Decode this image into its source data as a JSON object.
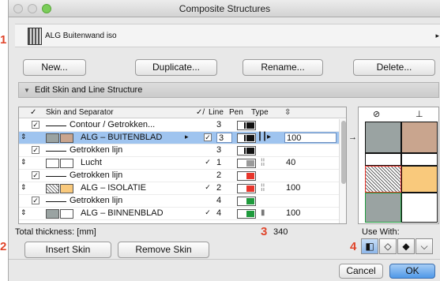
{
  "window": {
    "title": "Composite Structures"
  },
  "callouts": {
    "one": "1",
    "two": "2",
    "three": "3",
    "four": "4"
  },
  "composite": {
    "name": "ALG Buitenwand iso"
  },
  "toolbar": {
    "new": "New...",
    "duplicate": "Duplicate...",
    "rename": "Rename...",
    "delete": "Delete..."
  },
  "section": {
    "label": "Edit Skin and Line Structure",
    "toggle": "▼"
  },
  "table": {
    "headers": {
      "check": "✓",
      "name": "Skin and Separator",
      "line": "Line",
      "pen": "Pen",
      "type": "Type",
      "thk_icon": "⇳"
    },
    "rows": [
      {
        "name": "Contour / Getrokken...",
        "pen": "3"
      },
      {
        "name": "ALG – BUITENBLAD",
        "pen": "3",
        "thickness": "100"
      },
      {
        "name": "Getrokken lijn",
        "pen": "3"
      },
      {
        "name": "Lucht",
        "pen": "1",
        "thickness": "40"
      },
      {
        "name": "Getrokken lijn",
        "pen": "2"
      },
      {
        "name": "ALG – ISOLATIE",
        "pen": "2",
        "thickness": "100"
      },
      {
        "name": "Getrokken lijn",
        "pen": "4"
      },
      {
        "name": "ALG – BINNENBLAD",
        "pen": "4",
        "thickness": "100"
      }
    ]
  },
  "total": {
    "label": "Total thickness: [mm]",
    "value": "340"
  },
  "buttons": {
    "insert": "Insert Skin",
    "remove": "Remove Skin",
    "cancel": "Cancel",
    "ok": "OK"
  },
  "use_with": {
    "label": "Use With:"
  },
  "colors": {
    "grey": "#9aa3a2",
    "brown": "#c9a58e",
    "orange": "#f9c97c",
    "white": "#ffffff",
    "accent": "#4f98e8",
    "callout": "#e0452b"
  }
}
